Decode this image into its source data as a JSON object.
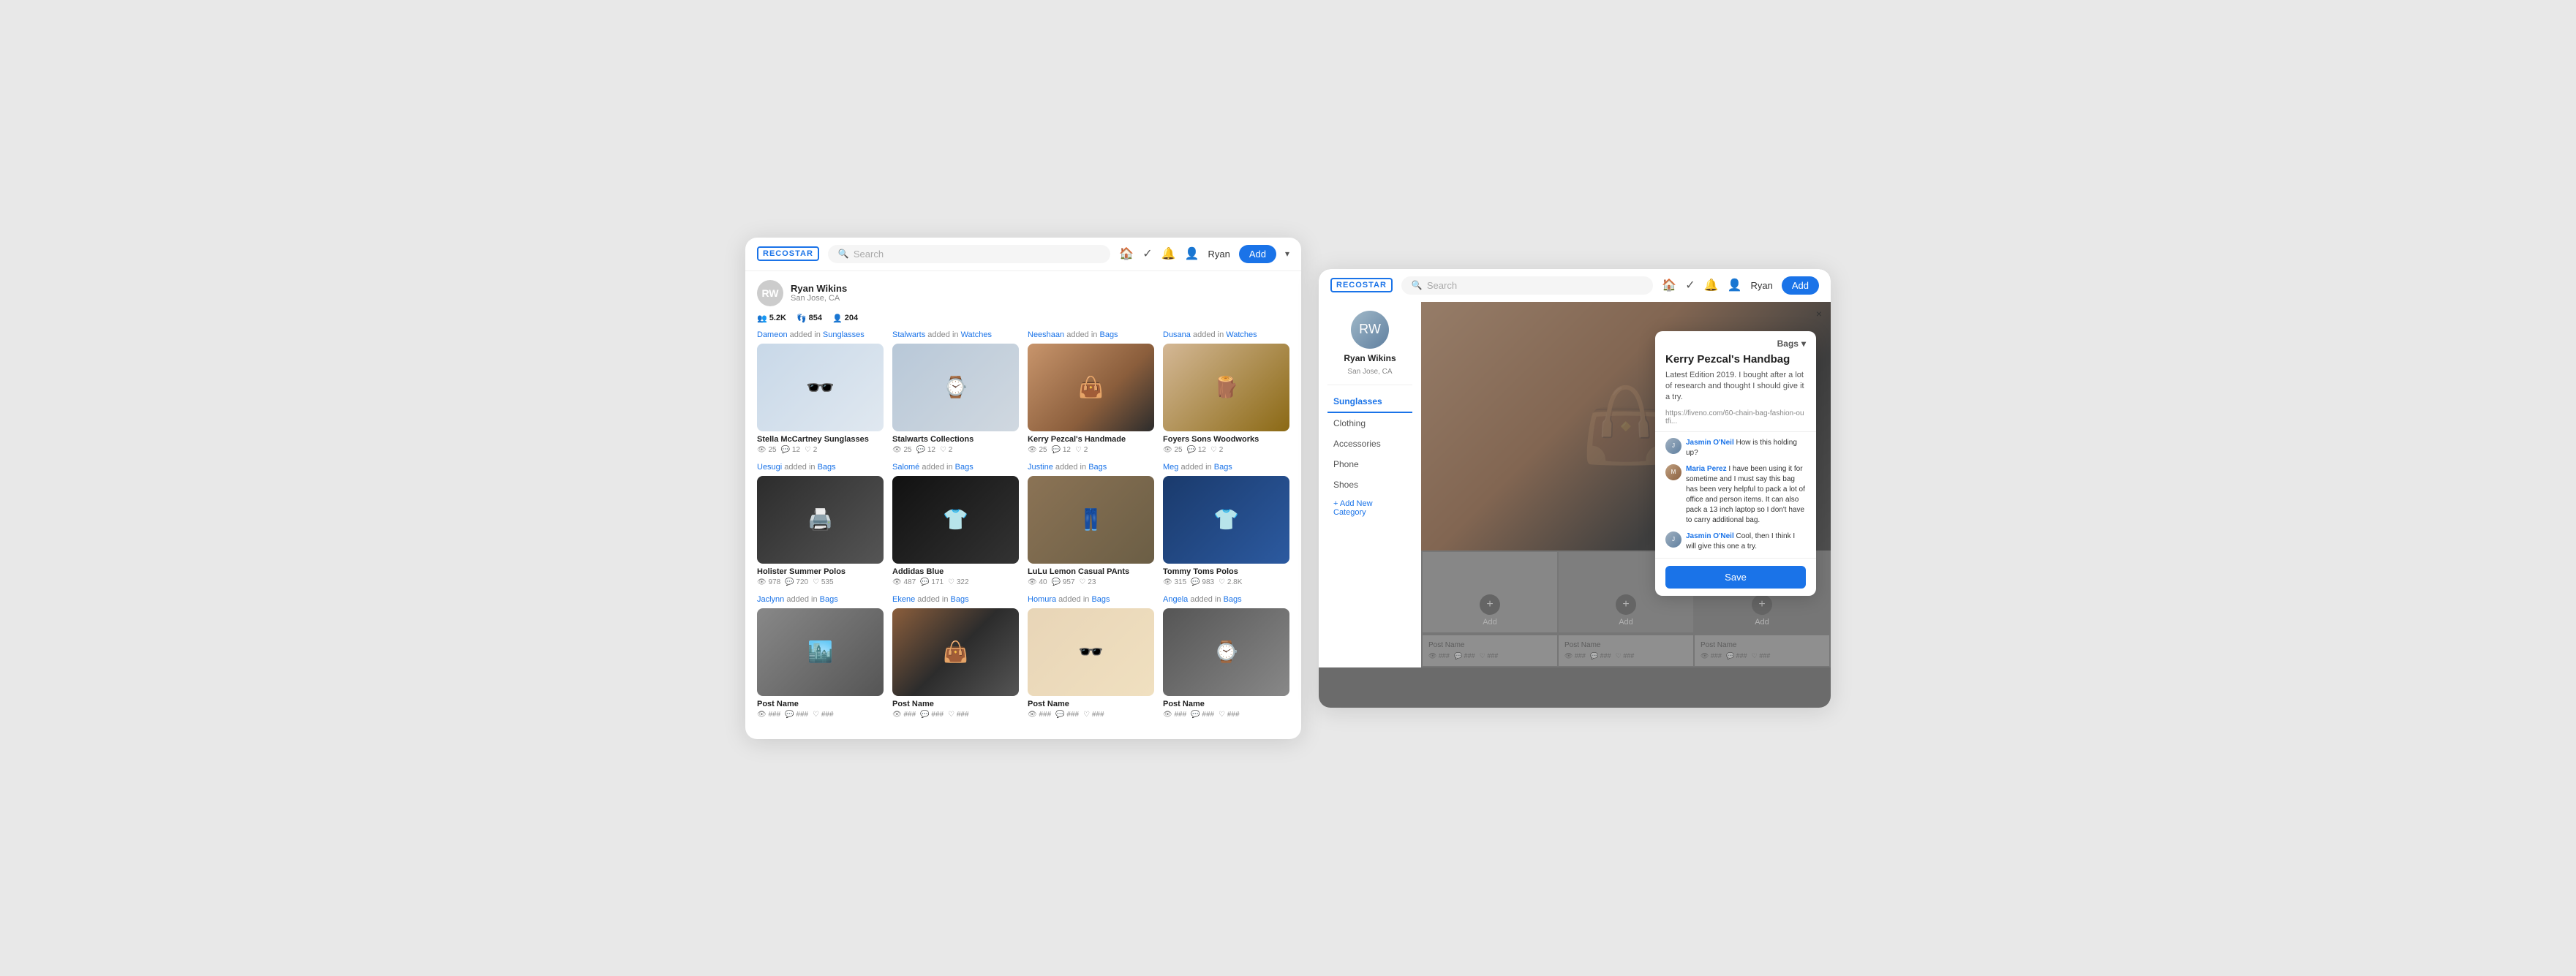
{
  "leftPanel": {
    "logo": "RECOSTAR",
    "search": {
      "placeholder": "Search"
    },
    "navIcons": [
      "home",
      "check-circle",
      "bell",
      "user"
    ],
    "userName": "Ryan",
    "addLabel": "Add",
    "profile": {
      "name": "Ryan Wikins",
      "location": "San Jose, CA",
      "stats": [
        {
          "icon": "👥",
          "value": "5.2K"
        },
        {
          "icon": "👣",
          "value": "854"
        },
        {
          "icon": "👤",
          "value": "204"
        }
      ]
    },
    "feedRows": [
      {
        "items": [
          {
            "attribution": "Dameon added in Sunglasses",
            "attributionUser": "Dameon",
            "attributionCategory": "Sunglasses",
            "imgClass": "img-sunglasses",
            "imgEmoji": "🕶️",
            "title": "Stella McCartney Sunglasses",
            "stats": [
              {
                "icon": "👁",
                "val": "25"
              },
              {
                "icon": "💬",
                "val": "12"
              },
              {
                "icon": "♡",
                "val": "2"
              }
            ]
          },
          {
            "attribution": "Stalwarts added in Watches",
            "attributionUser": "Stalwarts",
            "attributionCategory": "Watches",
            "imgClass": "img-watch",
            "imgEmoji": "⌚",
            "title": "Stalwarts Collections",
            "stats": [
              {
                "icon": "👁",
                "val": "25"
              },
              {
                "icon": "💬",
                "val": "12"
              },
              {
                "icon": "♡",
                "val": "2"
              }
            ]
          },
          {
            "attribution": "Neeshaan added in Bags",
            "attributionUser": "Neeshaan",
            "attributionCategory": "Bags",
            "imgClass": "img-bag1",
            "imgEmoji": "👜",
            "title": "Kerry Pezcal's Handmade",
            "stats": [
              {
                "icon": "👁",
                "val": "25"
              },
              {
                "icon": "💬",
                "val": "12"
              },
              {
                "icon": "♡",
                "val": "2"
              }
            ]
          },
          {
            "attribution": "Dusana added in Watches",
            "attributionUser": "Dusana",
            "attributionCategory": "Watches",
            "imgClass": "img-woodworks",
            "imgEmoji": "🪵",
            "title": "Foyers Sons Woodworks",
            "stats": [
              {
                "icon": "👁",
                "val": "25"
              },
              {
                "icon": "💬",
                "val": "12"
              },
              {
                "icon": "♡",
                "val": "2"
              }
            ]
          }
        ]
      },
      {
        "items": [
          {
            "attribution": "Uesugi added in Bags",
            "attributionUser": "Uesugi",
            "attributionCategory": "Bags",
            "imgClass": "img-printer",
            "imgEmoji": "🖨️",
            "title": "Holister Summer Polos",
            "stats": [
              {
                "icon": "👁",
                "val": "978"
              },
              {
                "icon": "💬",
                "val": "720"
              },
              {
                "icon": "♡",
                "val": "535"
              }
            ]
          },
          {
            "attribution": "Salomé added in Bags",
            "attributionUser": "Salomé",
            "attributionCategory": "Bags",
            "imgClass": "img-adidas",
            "imgEmoji": "👕",
            "title": "Addidas Blue",
            "stats": [
              {
                "icon": "👁",
                "val": "487"
              },
              {
                "icon": "💬",
                "val": "171"
              },
              {
                "icon": "♡",
                "val": "322"
              }
            ]
          },
          {
            "attribution": "Justine added in Bags",
            "attributionUser": "Justine",
            "attributionCategory": "Bags",
            "imgClass": "img-pants",
            "imgEmoji": "👖",
            "title": "LuLu Lemon Casual PAnts",
            "stats": [
              {
                "icon": "👁",
                "val": "40"
              },
              {
                "icon": "💬",
                "val": "957"
              },
              {
                "icon": "♡",
                "val": "23"
              }
            ]
          },
          {
            "attribution": "Meg added in Bags",
            "attributionUser": "Meg",
            "attributionCategory": "Bags",
            "imgClass": "img-polo",
            "imgEmoji": "👕",
            "title": "Tommy Toms Polos",
            "stats": [
              {
                "icon": "👁",
                "val": "315"
              },
              {
                "icon": "💬",
                "val": "983"
              },
              {
                "icon": "♡",
                "val": "2.8K"
              }
            ]
          }
        ]
      },
      {
        "items": [
          {
            "attribution": "Jaclynn added in Bags",
            "attributionUser": "Jaclynn",
            "attributionCategory": "Bags",
            "imgClass": "img-street",
            "imgEmoji": "🏙️",
            "title": "Post Name",
            "stats": [
              {
                "icon": "👁",
                "val": "###"
              },
              {
                "icon": "💬",
                "val": "###"
              },
              {
                "icon": "♡",
                "val": "###"
              }
            ]
          },
          {
            "attribution": "Ekene added in Bags",
            "attributionUser": "Ekene",
            "attributionCategory": "Bags",
            "imgClass": "img-brown",
            "imgEmoji": "👜",
            "title": "Post Name",
            "stats": [
              {
                "icon": "👁",
                "val": "###"
              },
              {
                "icon": "💬",
                "val": "###"
              },
              {
                "icon": "♡",
                "val": "###"
              }
            ]
          },
          {
            "attribution": "Homura added in Bags",
            "attributionUser": "Homura",
            "attributionCategory": "Bags",
            "imgClass": "img-sunglasses2",
            "imgEmoji": "🕶️",
            "title": "Post Name",
            "stats": [
              {
                "icon": "👁",
                "val": "###"
              },
              {
                "icon": "💬",
                "val": "###"
              },
              {
                "icon": "♡",
                "val": "###"
              }
            ]
          },
          {
            "attribution": "Angela added in Bags",
            "attributionUser": "Angela",
            "attributionCategory": "Bags",
            "imgClass": "img-watch2",
            "imgEmoji": "⌚",
            "title": "Post Name",
            "stats": [
              {
                "icon": "👁",
                "val": "###"
              },
              {
                "icon": "💬",
                "val": "###"
              },
              {
                "icon": "♡",
                "val": "###"
              }
            ]
          }
        ]
      }
    ]
  },
  "rightPanel": {
    "logo": "RECOSTAR",
    "search": {
      "placeholder": "Search"
    },
    "userName": "Ryan",
    "addLabel": "Add",
    "profile": {
      "name": "Ryan Wikins",
      "location": "San Jose, CA"
    },
    "sidebar": {
      "categories": [
        "Sunglasses",
        "Clothing",
        "Accessories",
        "Phone",
        "Shoes"
      ],
      "addCategory": "+ Add New Category",
      "activeCategory": "Sunglasses"
    },
    "popup": {
      "categoryLabel": "Bags",
      "title": "Kerry Pezcal's Handbag",
      "description": "Latest Edition 2019. I bought after a lot of research and thought I should give it a try.",
      "link": "https://fiveno.com/60-chain-bag-fashion-outfi...",
      "comments": [
        {
          "user": "Jasmin O'Neil",
          "text": "How is this holding up?"
        },
        {
          "user": "Maria Perez",
          "text": "I have been using it for sometime and I must say this bag has been very helpful to pack a lot of office and person items. It can also pack a 13 inch laptop so I don't have to carry additional bag."
        },
        {
          "user": "Jasmin O'Neil",
          "text": "Cool, then I think I will give this one a try."
        }
      ],
      "saveLabel": "Save",
      "closeLabel": "×"
    },
    "postGrid": [
      {
        "addLabel": "Add"
      },
      {
        "addLabel": "Add"
      },
      {
        "addLabel": "Add"
      }
    ],
    "postNames": [
      {
        "label": "Post Name",
        "stats": [
          {
            "icon": "👁",
            "val": "###"
          },
          {
            "icon": "💬",
            "val": "###"
          },
          {
            "icon": "♡",
            "val": "###"
          }
        ]
      },
      {
        "label": "Post Name",
        "stats": [
          {
            "icon": "👁",
            "val": "###"
          },
          {
            "icon": "💬",
            "val": "###"
          },
          {
            "icon": "♡",
            "val": "###"
          }
        ]
      },
      {
        "label": "Post Name",
        "stats": [
          {
            "icon": "👁",
            "val": "###"
          },
          {
            "icon": "💬",
            "val": "###"
          },
          {
            "icon": "♡",
            "val": "###"
          }
        ]
      }
    ]
  }
}
